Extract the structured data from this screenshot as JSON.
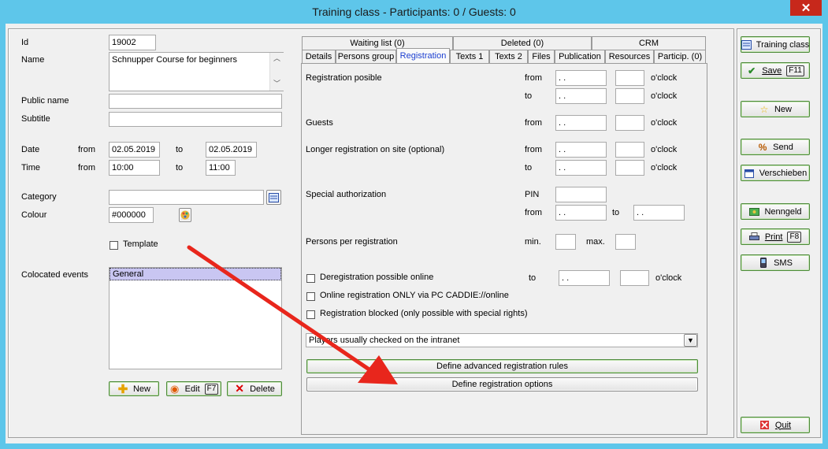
{
  "window": {
    "title": "Training class - Participants: 0 / Guests: 0",
    "close": "✕"
  },
  "form": {
    "id_label": "Id",
    "id_value": "19002",
    "name_label": "Name",
    "name_value": "Schnupper Course for beginners",
    "public_name_label": "Public name",
    "public_name_value": "",
    "subtitle_label": "Subtitle",
    "subtitle_value": "",
    "date_label": "Date",
    "date_from_label": "from",
    "date_from": "02.05.2019",
    "date_to_label": "to",
    "date_to": "02.05.2019",
    "time_label": "Time",
    "time_from_label": "from",
    "time_from": "10:00",
    "time_to_label": "to",
    "time_to": "11:00",
    "category_label": "Category",
    "category_value": "",
    "colour_label": "Colour",
    "colour_value": "#000000",
    "template_label": "Template",
    "colocated_label": "Colocated events",
    "colocated_items": [
      "General"
    ]
  },
  "left_buttons": {
    "new": "New",
    "edit": "Edit",
    "edit_key": "F7",
    "delete": "Delete"
  },
  "tabs_row1": [
    "Waiting list (0)",
    "Deleted (0)",
    "CRM"
  ],
  "tabs_row2": [
    "Details",
    "Persons group",
    "Registration",
    "Texts 1",
    "Texts 2",
    "Files",
    "Publication",
    "Resources",
    "Particip. (0)"
  ],
  "registration": {
    "possible_label": "Registration posible",
    "from": "from",
    "to": "to",
    "oclock": "o'clock",
    "date_placeholder": " .  .",
    "guests_label": "Guests",
    "longer_label": "Longer registration on site (optional)",
    "special_label": "Special authorization",
    "pin_label": "PIN",
    "persons_label": "Persons per registration",
    "min_label": "min.",
    "max_label": "max.",
    "dereg_label": "Deregistration possible online",
    "online_only_label": "Online registration ONLY via PC CADDIE://online",
    "blocked_label": "Registration blocked (only possible with special rights)",
    "dropdown_value": "Players usually checked on the intranet",
    "advanced_button": "Define advanced registration rules",
    "options_button": "Define registration options"
  },
  "right_buttons": {
    "training_class": "Training class",
    "save": "Save",
    "save_key": "F11",
    "new": "New",
    "send": "Send",
    "verschieben": "Verschieben",
    "nenngeld": "Nenngeld",
    "print": "Print",
    "print_key": "F8",
    "sms": "SMS",
    "quit": "Quit"
  },
  "colors": {
    "titlebar": "#5ec6ea",
    "close": "#c7281b",
    "arrow": "#e8261c",
    "selection": "#c9c6f2",
    "active_tab": "#1c3fd0"
  }
}
